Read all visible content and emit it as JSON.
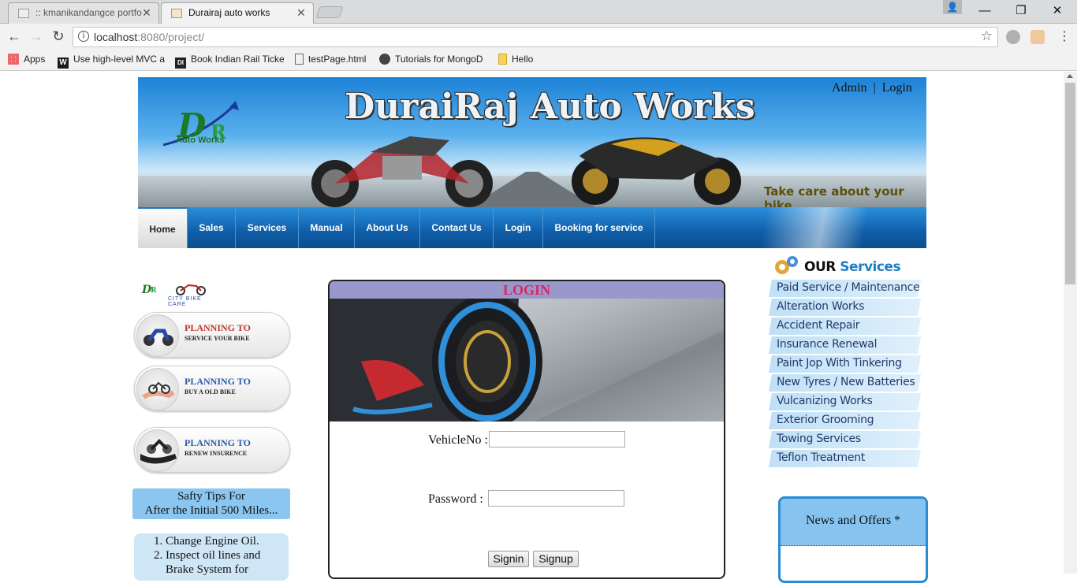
{
  "browser": {
    "tabs": [
      {
        "title": ":: kmanikandangce portfo",
        "active": false
      },
      {
        "title": "Durairaj auto works",
        "active": true
      }
    ],
    "url_host": "localhost",
    "url_rest": ":8080/project/",
    "bookmarks": [
      {
        "label": "Apps",
        "icon": "apps-grid-icon"
      },
      {
        "label": "Use high-level MVC a",
        "icon": "w-site-icon"
      },
      {
        "label": "Book Indian Rail Ticke",
        "icon": "di-site-icon"
      },
      {
        "label": "testPage.html",
        "icon": "file-icon"
      },
      {
        "label": "Tutorials for MongoD",
        "icon": "mongo-icon"
      },
      {
        "label": "Hello",
        "icon": "folder-icon"
      }
    ],
    "window_controls": {
      "minimize": "—",
      "restore": "❐",
      "close": "✕"
    }
  },
  "header": {
    "site_title": "DuraiRaj Auto Works",
    "tagline": "Take care about your bike",
    "logo_text": "Auto Works",
    "admin_link": "Admin",
    "separator": "|",
    "login_link": "Login"
  },
  "menu": [
    {
      "label": "Home",
      "active": true
    },
    {
      "label": "Sales",
      "active": false
    },
    {
      "label": "Services",
      "active": false
    },
    {
      "label": "Manual",
      "active": false
    },
    {
      "label": "About Us",
      "active": false
    },
    {
      "label": "Contact Us",
      "active": false
    },
    {
      "label": "Login",
      "active": false
    },
    {
      "label": "Booking for service",
      "active": false
    }
  ],
  "left": {
    "city_logo": "CITY BIKE CARE",
    "plans": [
      {
        "title": "PLANNING TO",
        "subtitle": "SERVICE YOUR BIKE"
      },
      {
        "title": "PLANNING TO",
        "subtitle": "BUY A OLD BIKE"
      },
      {
        "title": "PLANNING TO",
        "subtitle": "RENEW INSURENCE"
      }
    ],
    "safety_line1": "Safty Tips For",
    "safety_line2": "After the Initial 500 Miles...",
    "tips": [
      "Change Engine Oil.",
      "Inspect oil lines and",
      "Brake System for"
    ]
  },
  "login": {
    "heading": "LOGIN",
    "vehicle_label": "VehicleNo :",
    "vehicle_value": "",
    "password_label": "Password :",
    "password_value": "",
    "signin_label": "Signin",
    "signup_label": "Signup"
  },
  "services": {
    "our": "OUR",
    "heading": "Services",
    "items": [
      "Paid Service / Maintenance",
      "Alteration Works",
      "Accident Repair",
      "Insurance Renewal",
      "Paint Jop With Tinkering",
      "New Tyres / New Batteries",
      "Vulcanizing Works",
      "Exterior Grooming",
      "Towing Services",
      "Teflon Treatment"
    ]
  },
  "news": {
    "heading": "News and Offers *"
  },
  "colors": {
    "menu_blue": "#0f5ea8",
    "login_head": "#9898cc",
    "login_title": "#e0245e",
    "service_text": "#233a6b"
  }
}
